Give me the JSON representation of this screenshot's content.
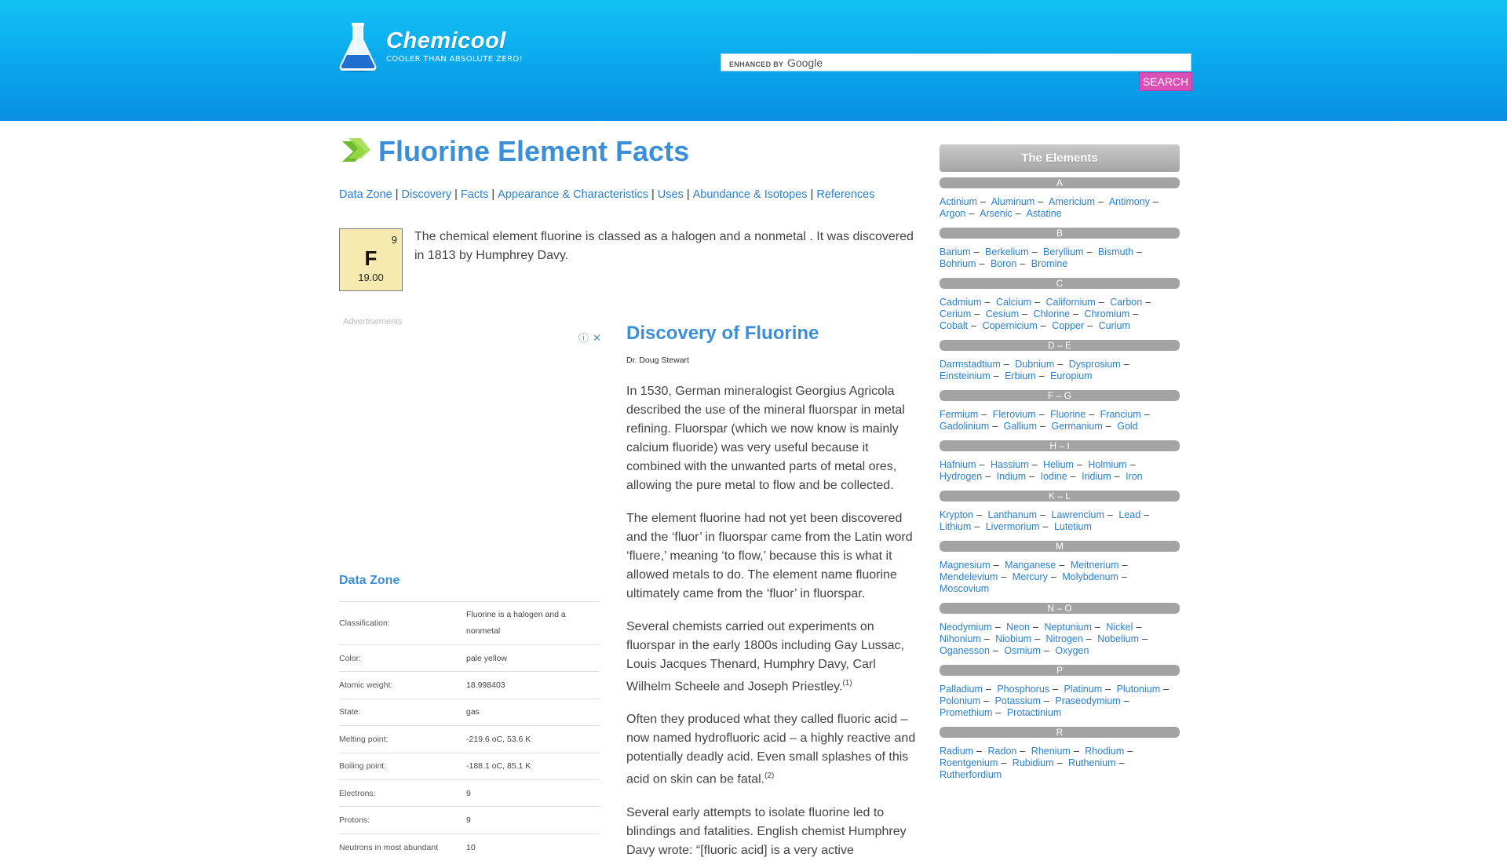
{
  "header": {
    "logo_title": "Chemicool",
    "logo_tagline": "COOLER THAN ABSOLUTE ZERO!",
    "search_branding": "ENHANCED BY",
    "search_google": "Google",
    "search_value": "",
    "search_button": "Search"
  },
  "page": {
    "title": "Fluorine Element Facts",
    "toc": [
      "Data Zone",
      "Discovery",
      "Facts",
      "Appearance & Characteristics",
      "Uses",
      "Abundance & Isotopes",
      "References"
    ],
    "element": {
      "number": "9",
      "symbol": "F",
      "weight": "19.00"
    },
    "intro": "The chemical element fluorine is classed as a halogen and a nonmetal . It was discovered in 1813 by Humphrey Davy.",
    "ads_label": "Advertisements"
  },
  "data_zone": {
    "title": "Data Zone",
    "rows": [
      {
        "label": "Classification:",
        "value": "Fluorine is a halogen and a nonmetal"
      },
      {
        "label": "Color:",
        "value": "pale yellow"
      },
      {
        "label": "Atomic weight:",
        "value": "18.998403"
      },
      {
        "label": "State:",
        "value": "gas"
      },
      {
        "label": "Melting point:",
        "value": "-219.6 oC, 53.6 K"
      },
      {
        "label": "Boiling point:",
        "value": "-188.1 oC, 85.1 K"
      },
      {
        "label": "Electrons:",
        "value": "9"
      },
      {
        "label": "Protons:",
        "value": "9"
      },
      {
        "label": "Neutrons in most abundant",
        "value": "10"
      }
    ]
  },
  "discovery": {
    "title": "Discovery of Fluorine",
    "author": "Dr. Doug Stewart",
    "p1": "In 1530, German mineralogist Georgius Agricola described the use of the mineral fluorspar in metal refining. Fluorspar (which we now know is mainly calcium fluoride) was very useful because it combined with the unwanted parts of metal ores, allowing the pure metal to flow and be collected.",
    "p2": "The element fluorine had not yet been discovered and the ‘fluor’ in fluorspar came from the Latin word ‘fluere,’ meaning ‘to flow,’ because this is what it allowed metals to do. The element name fluorine ultimately came from the ‘fluor’ in fluorspar.",
    "p3": "Several chemists carried out experiments on fluorspar in the early 1800s including Gay Lussac, Louis Jacques Thenard, Humphry Davy, Carl Wilhelm Scheele and Joseph Priestley.",
    "p3_ref": "(1)",
    "p4": "Often they produced what they called fluoric acid – now named hydrofluoric acid – a highly reactive and potentially deadly acid. Even small splashes of this acid on skin can be fatal.",
    "p4_ref": "(2)",
    "p5": "Several early attempts to isolate fluorine led to blindings and fatalities. English chemist Humphrey Davy wrote: “[fluoric acid] is a very active"
  },
  "sidebar": {
    "title": "The Elements",
    "groups": [
      {
        "letter": "A",
        "items": [
          "Actinium",
          "Aluminum",
          "Americium",
          "Antimony",
          "Argon",
          "Arsenic",
          "Astatine"
        ]
      },
      {
        "letter": "B",
        "items": [
          "Barium",
          "Berkelium",
          "Beryllium",
          "Bismuth",
          "Bohrium",
          "Boron",
          "Bromine"
        ]
      },
      {
        "letter": "C",
        "items": [
          "Cadmium",
          "Calcium",
          "Californium",
          "Carbon",
          "Cerium",
          "Cesium",
          "Chlorine",
          "Chromium",
          "Cobalt",
          "Copernicium",
          "Copper",
          "Curium"
        ]
      },
      {
        "letter": "D – E",
        "items": [
          "Darmstadtium",
          "Dubnium",
          "Dysprosium",
          "Einsteinium",
          "Erbium",
          "Europium"
        ]
      },
      {
        "letter": "F – G",
        "items": [
          "Fermium",
          "Flerovium",
          "Fluorine",
          "Francium",
          "Gadolinium",
          "Gallium",
          "Germanium",
          "Gold"
        ]
      },
      {
        "letter": "H – I",
        "items": [
          "Hafnium",
          "Hassium",
          "Helium",
          "Holmium",
          "Hydrogen",
          "Indium",
          "Iodine",
          "Iridium",
          "Iron"
        ]
      },
      {
        "letter": "K – L",
        "items": [
          "Krypton",
          "Lanthanum",
          "Lawrencium",
          "Lead",
          "Lithium",
          "Livermorium",
          "Lutetium"
        ]
      },
      {
        "letter": "M",
        "items": [
          "Magnesium",
          "Manganese",
          "Meitnerium",
          "Mendelevium",
          "Mercury",
          "Molybdenum",
          "Moscovium"
        ]
      },
      {
        "letter": "N – O",
        "items": [
          "Neodymium",
          "Neon",
          "Neptunium",
          "Nickel",
          "Nihonium",
          "Niobium",
          "Nitrogen",
          "Nobelium",
          "Oganesson",
          "Osmium",
          "Oxygen"
        ]
      },
      {
        "letter": "P",
        "items": [
          "Palladium",
          "Phosphorus",
          "Platinum",
          "Plutonium",
          "Polonium",
          "Potassium",
          "Praseodymium",
          "Promethium",
          "Protactinium"
        ]
      },
      {
        "letter": "R",
        "items": [
          "Radium",
          "Radon",
          "Rhenium",
          "Rhodium",
          "Roentgenium",
          "Rubidium",
          "Ruthenium",
          "Rutherfordium"
        ]
      }
    ]
  }
}
